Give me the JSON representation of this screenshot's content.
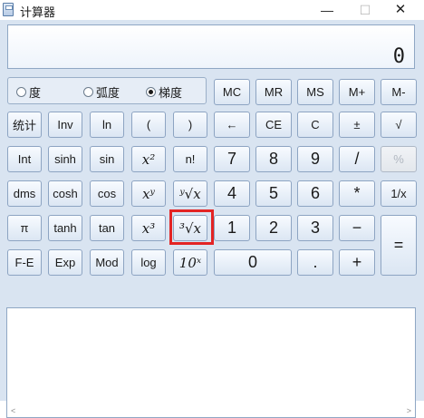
{
  "window": {
    "title": "计算器",
    "min_label": "—",
    "max_label": "☐",
    "close_label": "✕"
  },
  "display": {
    "value": "0"
  },
  "angle_modes": [
    {
      "label": "度",
      "selected": false
    },
    {
      "label": "弧度",
      "selected": false
    },
    {
      "label": "梯度",
      "selected": true
    }
  ],
  "memory": [
    "MC",
    "MR",
    "MS",
    "M+",
    "M-"
  ],
  "rows": [
    [
      "统计",
      "Inv",
      "ln",
      "(",
      ")",
      "←",
      "CE",
      "C",
      "±",
      "√"
    ],
    [
      "Int",
      "sinh",
      "sin",
      "x²",
      "n!",
      "7",
      "8",
      "9",
      "/",
      "%"
    ],
    [
      "dms",
      "cosh",
      "cos",
      "xʸ",
      "ʸ√x",
      "4",
      "5",
      "6",
      "*",
      "1/x"
    ],
    [
      "π",
      "tanh",
      "tan",
      "x³",
      "³√x",
      "1",
      "2",
      "3",
      "−",
      "="
    ],
    [
      "F-E",
      "Exp",
      "Mod",
      "log",
      "10ˣ",
      "0",
      ".",
      "+"
    ]
  ],
  "history": {
    "scroll_left": "<",
    "scroll_right": ">"
  },
  "colors": {
    "background": "#d9e4f1",
    "highlight": "#e32424"
  }
}
